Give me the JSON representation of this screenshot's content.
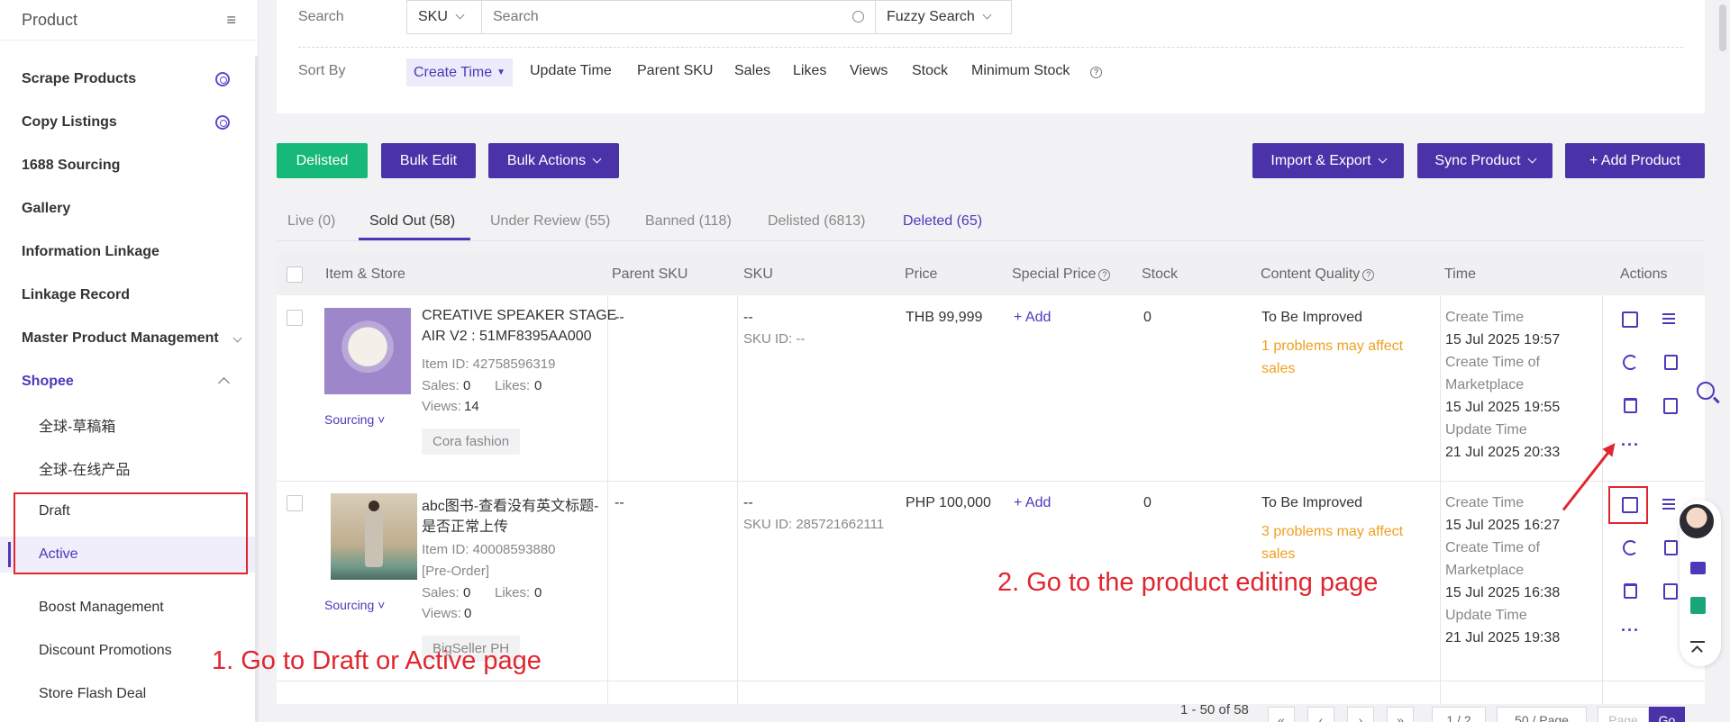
{
  "sidebar": {
    "title": "Product",
    "items": [
      {
        "label": "Scrape Products"
      },
      {
        "label": "Copy Listings"
      },
      {
        "label": "1688 Sourcing"
      },
      {
        "label": "Gallery"
      },
      {
        "label": "Information Linkage"
      },
      {
        "label": "Linkage Record"
      },
      {
        "label": "Master Product Management"
      },
      {
        "label": "Shopee"
      },
      {
        "label": "全球-草稿箱"
      },
      {
        "label": "全球-在线产品"
      },
      {
        "label": "Draft"
      },
      {
        "label": "Active"
      },
      {
        "label": "Boost Management"
      },
      {
        "label": "Discount Promotions"
      },
      {
        "label": "Store Flash Deal"
      }
    ]
  },
  "search": {
    "label": "Search",
    "field_type": "SKU",
    "placeholder": "Search",
    "mode": "Fuzzy Search"
  },
  "sort": {
    "label": "Sort By",
    "options": [
      "Create Time",
      "Update Time",
      "Parent SKU",
      "Sales",
      "Likes",
      "Views",
      "Stock",
      "Minimum Stock"
    ]
  },
  "toolbar": {
    "delisted": "Delisted",
    "bulk_edit": "Bulk Edit",
    "bulk_actions": "Bulk Actions",
    "import_export": "Import & Export",
    "sync_product": "Sync Product",
    "add_product": "+ Add Product"
  },
  "tabs": [
    {
      "label": "Live (0)"
    },
    {
      "label": "Sold Out (58)"
    },
    {
      "label": "Under Review (55)"
    },
    {
      "label": "Banned (118)"
    },
    {
      "label": "Delisted (6813)"
    },
    {
      "label": "Deleted (65)"
    }
  ],
  "table": {
    "columns": [
      "Item & Store",
      "Parent SKU",
      "SKU",
      "Price",
      "Special Price",
      "Stock",
      "Content Quality",
      "Time",
      "Actions"
    ],
    "rows": [
      {
        "title_line1": "CREATIVE SPEAKER STAGE",
        "title_line2": "AIR V2 : 51MF8395AA000",
        "item_id": "Item ID: 42758596319",
        "extra": "",
        "sales_label": "Sales:",
        "sales": "0",
        "likes_label": "Likes:",
        "likes": "0",
        "views_label": "Views:",
        "views": "14",
        "sourcing": "Sourcing",
        "store": "Cora fashion",
        "parent_sku": "--",
        "sku": "--",
        "sku_id": "SKU ID: --",
        "price": "THB 99,999",
        "special_price": "+ Add",
        "stock": "0",
        "quality": "To Be Improved",
        "quality_note": "1 problems may affect sales",
        "create_label": "Create Time",
        "create_time": "15 Jul 2025 19:57",
        "market_label_1": "Create Time of",
        "market_label_2": "Marketplace",
        "market_time": "15 Jul 2025 19:55",
        "update_label": "Update Time",
        "update_time": "21 Jul 2025 20:33"
      },
      {
        "title_line1": "abc图书-查看没有英文标题-",
        "title_line2": "是否正常上传",
        "item_id": "Item ID: 40008593880",
        "extra": "[Pre-Order]",
        "sales_label": "Sales:",
        "sales": "0",
        "likes_label": "Likes:",
        "likes": "0",
        "views_label": "Views:",
        "views": "0",
        "sourcing": "Sourcing",
        "store": "BigSeller PH",
        "parent_sku": "--",
        "sku": "--",
        "sku_id": "SKU ID: 285721662111",
        "price": "PHP 100,000",
        "special_price": "+ Add",
        "stock": "0",
        "quality": "To Be Improved",
        "quality_note": "3 problems may affect sales",
        "create_label": "Create Time",
        "create_time": "15 Jul 2025 16:27",
        "market_label_1": "Create Time of",
        "market_label_2": "Marketplace",
        "market_time": "15 Jul 2025 16:38",
        "update_label": "Update Time",
        "update_time": "21 Jul 2025 19:38"
      }
    ]
  },
  "annotations": {
    "step1": "1. Go to Draft or Active page",
    "step2": "2. Go to the product editing page"
  },
  "pagination": {
    "range": "1 - 50 of 58",
    "page": "1 / 2",
    "per_page": "50 / Page",
    "page_input_placeholder": "Page",
    "go": "Go"
  },
  "colors": {
    "accent": "#4a3aba",
    "green": "#17b978",
    "annotation_red": "#e0262f",
    "warning_orange": "#f0a020"
  }
}
